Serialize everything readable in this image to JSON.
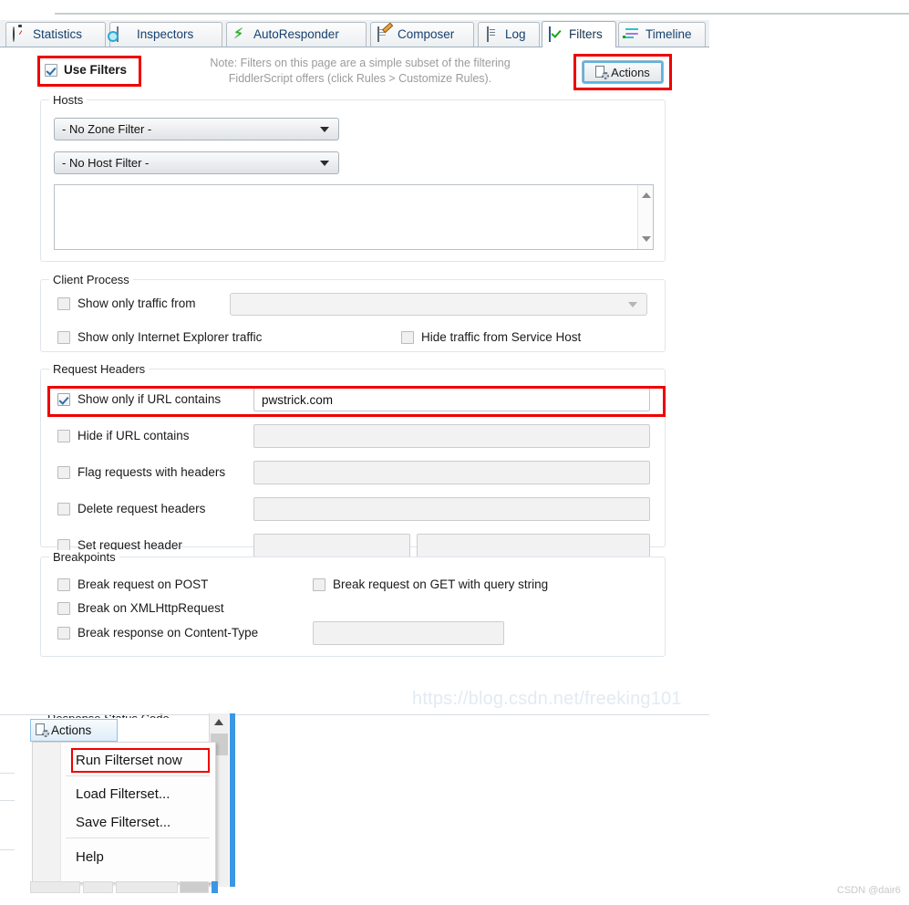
{
  "tabs": [
    {
      "label": "Statistics",
      "icon": "stopwatch-icon",
      "active": false
    },
    {
      "label": "Inspectors",
      "icon": "inspectors-icon",
      "active": false
    },
    {
      "label": "AutoResponder",
      "icon": "lightning-icon",
      "active": false
    },
    {
      "label": "Composer",
      "icon": "compose-pencil-icon",
      "active": false
    },
    {
      "label": "Log",
      "icon": "document-icon",
      "active": false
    },
    {
      "label": "Filters",
      "icon": "checked-box-icon",
      "active": true
    },
    {
      "label": "Timeline",
      "icon": "timeline-icon",
      "active": false
    }
  ],
  "toolbar": {
    "use_filters_label": "Use Filters",
    "use_filters_checked": true,
    "note_line1": "Note: Filters on this page are a simple subset of the filtering",
    "note_line2": "FiddlerScript offers (click Rules > Customize Rules).",
    "actions_label": "Actions"
  },
  "hosts": {
    "group_label": "Hosts",
    "zone_filter_value": "- No Zone Filter -",
    "host_filter_value": "- No Host Filter -",
    "host_list_value": ""
  },
  "client_process": {
    "group_label": "Client Process",
    "show_only_traffic_from_label": "Show only traffic from",
    "show_only_traffic_from_checked": false,
    "process_combo_value": "",
    "show_only_ie_label": "Show only Internet Explorer traffic",
    "show_only_ie_checked": false,
    "hide_service_host_label": "Hide traffic from Service Host",
    "hide_service_host_checked": false
  },
  "request_headers": {
    "group_label": "Request Headers",
    "rows": [
      {
        "label": "Show only if URL contains",
        "checked": true,
        "value": "pwstrick.com",
        "highlight": true
      },
      {
        "label": "Hide if URL contains",
        "checked": false,
        "value": "",
        "highlight": false
      },
      {
        "label": "Flag requests with headers",
        "checked": false,
        "value": "",
        "highlight": false
      },
      {
        "label": "Delete request headers",
        "checked": false,
        "value": "",
        "highlight": false
      },
      {
        "label": "Set request header",
        "checked": false,
        "value": "",
        "value2": "",
        "highlight": false
      }
    ]
  },
  "breakpoints": {
    "group_label": "Breakpoints",
    "break_post_label": "Break request on POST",
    "break_post_checked": false,
    "break_get_label": "Break request on GET with query string",
    "break_get_checked": false,
    "break_xhr_label": "Break on XMLHttpRequest",
    "break_xhr_checked": false,
    "break_content_type_label": "Break response on Content-Type",
    "break_content_type_checked": false,
    "break_content_type_value": ""
  },
  "cut_off_group_label": "Response Status Code",
  "watermark": "https://blog.csdn.net/freeking101",
  "signature": "CSDN @dair6",
  "actions_menu": {
    "button_label": "Actions",
    "items": [
      {
        "label": "Run Filterset now",
        "highlight": true
      },
      {
        "label": "Load Filterset...",
        "highlight": false
      },
      {
        "label": "Save Filterset...",
        "highlight": false
      },
      {
        "label": "Help",
        "highlight": false
      }
    ]
  },
  "colors": {
    "highlight_red": "#ef0000",
    "accent_blue": "#3b97e3",
    "tab_text": "#16406e"
  }
}
